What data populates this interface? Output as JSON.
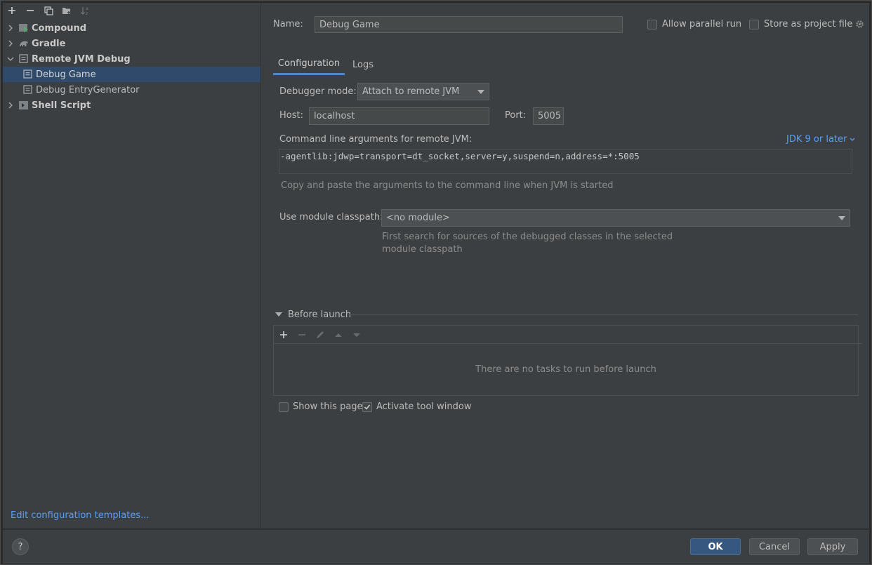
{
  "toolbar": {
    "icons": [
      "add-icon",
      "remove-icon",
      "copy-icon",
      "new-folder-icon",
      "sort-icon"
    ]
  },
  "tree": {
    "items": [
      {
        "label": "Compound",
        "icon": "compound-icon",
        "expanded": false,
        "bold": true,
        "level": 0
      },
      {
        "label": "Gradle",
        "icon": "gradle-icon",
        "expanded": false,
        "bold": true,
        "level": 0
      },
      {
        "label": "Remote JVM Debug",
        "icon": "remote-debug-icon",
        "expanded": true,
        "bold": true,
        "level": 0
      },
      {
        "label": "Debug Game",
        "icon": "remote-debug-icon",
        "selected": true,
        "level": 1
      },
      {
        "label": "Debug EntryGenerator",
        "icon": "remote-debug-icon",
        "level": 1
      },
      {
        "label": "Shell Script",
        "icon": "shell-script-icon",
        "expanded": false,
        "bold": true,
        "level": 0
      }
    ],
    "edit_templates_link": "Edit configuration templates..."
  },
  "form": {
    "name_label": "Name:",
    "name_value": "Debug Game",
    "allow_parallel_label": "Allow parallel run",
    "allow_parallel_checked": false,
    "store_project_label": "Store as project file",
    "store_project_checked": false,
    "tabs": [
      {
        "label": "Configuration",
        "active": true
      },
      {
        "label": "Logs",
        "active": false
      }
    ],
    "debugger_mode_label": "Debugger mode:",
    "debugger_mode_value": "Attach to remote JVM",
    "host_label": "Host:",
    "host_value": "localhost",
    "port_label": "Port:",
    "port_value": "5005",
    "cmd_args_label": "Command line arguments for remote JVM:",
    "jdk_link": "JDK 9 or later",
    "cmd_args_value": "-agentlib:jdwp=transport=dt_socket,server=y,suspend=n,address=*:5005",
    "cmd_hint": "Copy and paste the arguments to the command line when JVM is started",
    "module_label": "Use module classpath:",
    "module_value": "<no module>",
    "module_hint_line1": "First search for sources of the debugged classes in the selected",
    "module_hint_line2": "module classpath",
    "before_launch_label": "Before launch",
    "before_launch_empty": "There are no tasks to run before launch",
    "show_page_label": "Show this page",
    "show_page_checked": false,
    "activate_tool_label": "Activate tool window",
    "activate_tool_checked": true
  },
  "buttons": {
    "help": "?",
    "ok": "OK",
    "cancel": "Cancel",
    "apply": "Apply"
  },
  "colors": {
    "accent": "#589df6",
    "selection": "#2f4a6b",
    "primary_button": "#365880",
    "background": "#3c3f41"
  }
}
